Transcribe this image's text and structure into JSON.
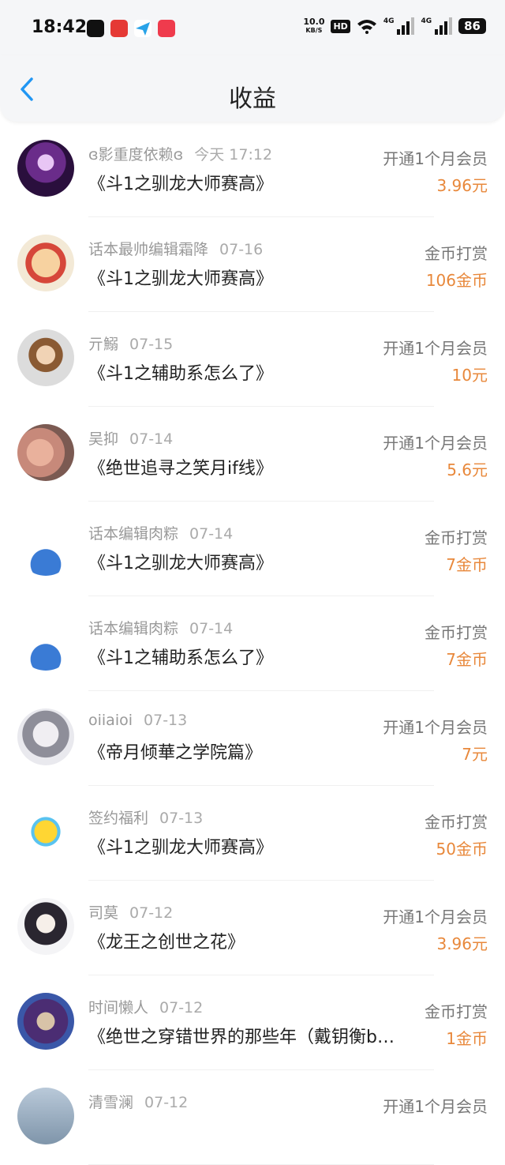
{
  "status_bar": {
    "time": "18:42",
    "speed_value": "10.0",
    "speed_unit": "KB/S",
    "hd": "HD",
    "network1": "4G",
    "network2": "4G",
    "battery": "86"
  },
  "header": {
    "title": "收益",
    "back_icon": "chevron-left-icon",
    "accent_color": "#2196f3"
  },
  "colors": {
    "amount": "#e8883b"
  },
  "rows": [
    {
      "user": "ɞ影重度依赖ɞ",
      "date": "今天 17:12",
      "book": "《斗1之驯龙大师赛高》",
      "type": "开通1个月会员",
      "amount": "3.96元"
    },
    {
      "user": "话本最帅编辑霜降",
      "date": "07-16",
      "book": "《斗1之驯龙大师赛高》",
      "type": "金币打赏",
      "amount": "106金币"
    },
    {
      "user": "亓鰯",
      "date": "07-15",
      "book": "《斗1之辅助系怎么了》",
      "type": "开通1个月会员",
      "amount": "10元"
    },
    {
      "user": "吴抑",
      "date": "07-14",
      "book": "《绝世追寻之笑月if线》",
      "type": "开通1个月会员",
      "amount": "5.6元"
    },
    {
      "user": "话本编辑肉粽",
      "date": "07-14",
      "book": "《斗1之驯龙大师赛高》",
      "type": "金币打赏",
      "amount": "7金币"
    },
    {
      "user": "话本编辑肉粽",
      "date": "07-14",
      "book": "《斗1之辅助系怎么了》",
      "type": "金币打赏",
      "amount": "7金币"
    },
    {
      "user": "oiiaioi",
      "date": "07-13",
      "book": "《帝月倾華之学院篇》",
      "type": "开通1个月会员",
      "amount": "7元"
    },
    {
      "user": "签约福利",
      "date": "07-13",
      "book": "《斗1之驯龙大师赛高》",
      "type": "金币打赏",
      "amount": "50金币"
    },
    {
      "user": "司莫",
      "date": "07-12",
      "book": "《龙王之创世之花》",
      "type": "开通1个月会员",
      "amount": "3.96元"
    },
    {
      "user": "时间懒人",
      "date": "07-12",
      "book": "《绝世之穿错世界的那些年（戴钥衡b…",
      "type": "金币打赏",
      "amount": "1金币"
    },
    {
      "user": "清雪澜",
      "date": "07-12",
      "book": "",
      "type": "开通1个月会员",
      "amount": ""
    }
  ]
}
